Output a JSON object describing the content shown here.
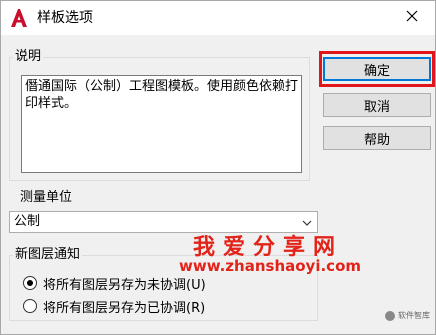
{
  "window": {
    "title": "样板选项",
    "app_icon": "autocad-a-icon",
    "close_icon": "close-icon"
  },
  "description": {
    "group_label": "说明",
    "text": "僭通国际（公制）工程图模板。使用颜色依赖打印样式。"
  },
  "buttons": {
    "ok": "确定",
    "cancel": "取消",
    "help": "帮助"
  },
  "units": {
    "group_label": "测量单位",
    "selected": "公制"
  },
  "layer_notify": {
    "group_label": "新图层通知",
    "options": [
      {
        "label": "将所有图层另存为未协调(U)",
        "checked": true
      },
      {
        "label": "将所有图层另存为已协调(R)",
        "checked": false
      }
    ]
  },
  "watermark": {
    "title": "我爱分享网",
    "url": "www.zhanshaoyi.com",
    "small": "软件智库"
  },
  "colors": {
    "accent": "#0078d7",
    "highlight": "#e0161b",
    "watermark": "#e2231a"
  }
}
